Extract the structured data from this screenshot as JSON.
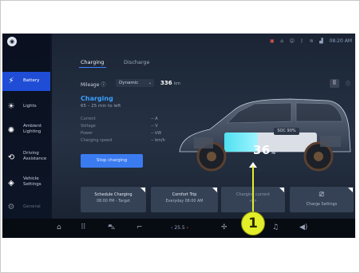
{
  "status_bar": {
    "time": "08:20 AM"
  },
  "sidebar": {
    "items": [
      {
        "label": "Battery",
        "icon": "lightning-icon",
        "active": true
      },
      {
        "label": "Lights",
        "icon": "sun-icon"
      },
      {
        "label": "Ambient Lighting",
        "icon": "ambient-icon"
      },
      {
        "label": "Driving Assistance",
        "icon": "steering-icon"
      },
      {
        "label": "Vehicle Settings",
        "icon": "layers-icon"
      },
      {
        "label": "General",
        "icon": "gear-icon"
      }
    ]
  },
  "tabs": [
    {
      "label": "Charging",
      "active": true
    },
    {
      "label": "Discharge"
    }
  ],
  "mileage": {
    "label": "Mileage",
    "mode": "Dynamic",
    "value": "336",
    "unit": "km"
  },
  "charging": {
    "title": "Charging",
    "time_left": "65 – 25 min to left",
    "rows": [
      {
        "label": "Current",
        "value": "-- A"
      },
      {
        "label": "Voltage",
        "value": "-- V"
      },
      {
        "label": "Power",
        "value": "-- kW"
      },
      {
        "label": "Charging speed",
        "value": "-- km/h"
      }
    ],
    "stop_label": "Stop charging"
  },
  "vehicle": {
    "soc_label": "SOC 90%",
    "percent": "36",
    "percent_unit": "%",
    "fill_fraction": 0.36
  },
  "cards": [
    {
      "title": "Schedule Charging",
      "sub": "08:00 PM - Target"
    },
    {
      "title": "Comfort Trip",
      "sub": "Everyday  08:00 AM"
    },
    {
      "title": "Charging current",
      "sub": "<      >"
    },
    {
      "title": "Charge Settings",
      "sub": ""
    }
  ],
  "dock": {
    "temp": "25.5"
  },
  "callout": {
    "number": "1"
  },
  "colors": {
    "accent": "#3a86ff",
    "active_nav": "#1f4dd6",
    "callout": "#e3ee2a",
    "battery_fill": "#4ee0f0"
  }
}
